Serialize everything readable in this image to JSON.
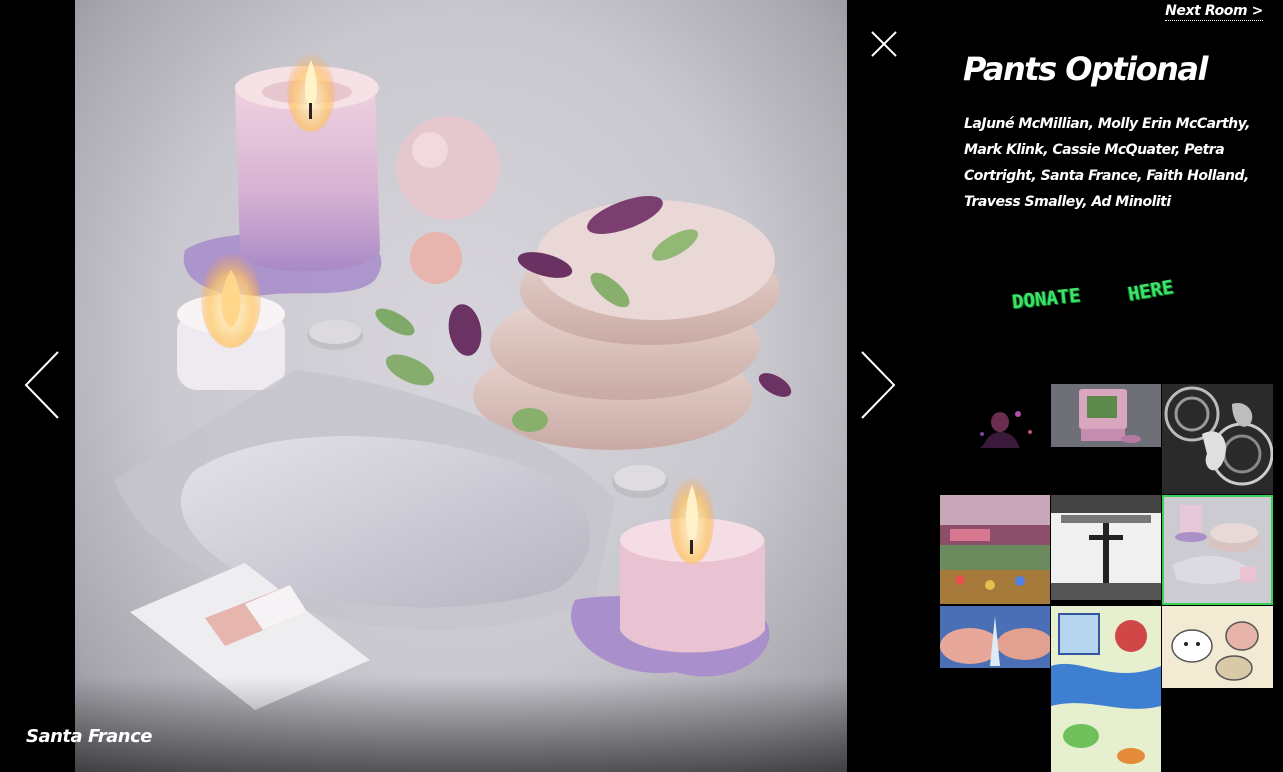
{
  "viewer": {
    "caption": "Santa France",
    "close_label": "close",
    "prev_label": "previous",
    "next_label": "next"
  },
  "sidebar": {
    "next_room_label": "Next Room >",
    "title": "Pants Optional",
    "artists": "LaJuné McMillian, Molly Erin McCarthy, Mark Klink, Cassie McQuater, Petra Cortright, Santa France, Faith Holland, Travess Smalley, Ad Minoliti",
    "donate": {
      "word1": "DONATE",
      "word2": "HERE"
    },
    "thumbnails": [
      {
        "name": "thumb-dark-figure",
        "selected": false
      },
      {
        "name": "thumb-pink-tv",
        "selected": false
      },
      {
        "name": "thumb-bw-pattern",
        "selected": false
      },
      {
        "name": "thumb-pixel-game",
        "selected": false
      },
      {
        "name": "thumb-bw-cross",
        "selected": false
      },
      {
        "name": "thumb-candles",
        "selected": true
      },
      {
        "name": "thumb-hands-water",
        "selected": false
      },
      {
        "name": "thumb-watercolor-map",
        "selected": false
      },
      {
        "name": "thumb-cartoon-cats",
        "selected": false
      }
    ]
  },
  "colors": {
    "accent": "#38d150",
    "donate_green": "#3ee26a",
    "background": "#000000"
  }
}
